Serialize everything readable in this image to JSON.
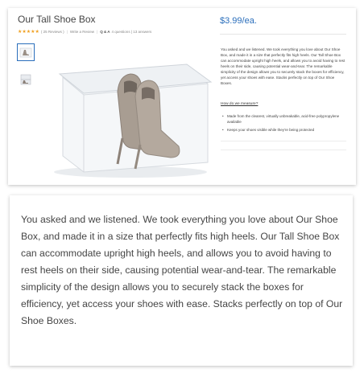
{
  "product": {
    "title": "Our Tall Shoe Box",
    "rating_stars": "★★★★★",
    "reviews": "( 25 Reviews )",
    "write_review": "Write a Review",
    "qa_label": "Q & A",
    "qa_counts": "4 questions | 13 answers",
    "price": "$3.99/ea.",
    "description": "You asked and we listened. We took everything you love about Our Shoe Box, and made it in a size that perfectly fits high heels. Our Tall Shoe Box can accommodate upright high heels, and allows you to avoid having to rest heels on their side, causing potential wear-and-tear. The remarkable simplicity of the design allows you to securely stack the boxes for efficiency, yet access your shoes with ease. Stacks perfectly on top of Our Shoe Boxes.",
    "measure_link": "How do we measure?",
    "features": [
      "Made from the clearest, virtually unbreakable, acid-free polypropylene available",
      "Keeps your shoes visible while they're being protected"
    ]
  },
  "colors": {
    "accent": "#2a6ebb",
    "star": "#f0a020"
  }
}
